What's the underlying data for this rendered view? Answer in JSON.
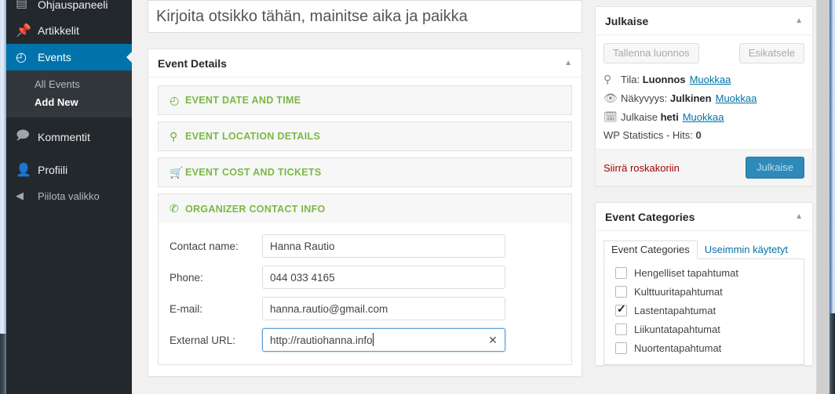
{
  "sidebar": {
    "items": [
      {
        "label": "Ohjauspaneeli",
        "icon": "dashboard-icon",
        "glyph": "▤",
        "state": "partial"
      },
      {
        "label": "Artikkelit",
        "icon": "pin-icon",
        "glyph": "📌",
        "state": "normal"
      },
      {
        "label": "Events",
        "icon": "events-clock-icon",
        "glyph": "◴",
        "state": "current"
      },
      {
        "label": "Kommentit",
        "icon": "comment-icon",
        "glyph": "🗩",
        "state": "normal"
      },
      {
        "label": "Profiili",
        "icon": "user-icon",
        "glyph": "👤",
        "state": "normal"
      }
    ],
    "submenu": [
      {
        "label": "All Events",
        "current": false
      },
      {
        "label": "Add New",
        "current": true
      }
    ],
    "collapse": {
      "label": "Piilota valikko",
      "icon": "collapse-arrow-icon",
      "glyph": "◀"
    }
  },
  "editor": {
    "title_placeholder": "Kirjoita otsikko tähän, mainitse aika ja paikka",
    "title_value": ""
  },
  "event_details": {
    "panel_title": "Event Details",
    "toggle_glyph": "▲",
    "sections": [
      {
        "label": "EVENT DATE AND TIME",
        "icon": "clock-icon",
        "glyph": "◴",
        "open": false
      },
      {
        "label": "EVENT LOCATION DETAILS",
        "icon": "map-pin-icon",
        "glyph": "⚲",
        "open": false
      },
      {
        "label": "EVENT COST AND TICKETS",
        "icon": "shopping-cart-icon",
        "glyph": "🛒",
        "open": false
      },
      {
        "label": "ORGANIZER CONTACT INFO",
        "icon": "phone-icon",
        "glyph": "✆",
        "open": true
      }
    ],
    "contact_fields": [
      {
        "label": "Contact name:",
        "value": "Hanna Rautio",
        "focused": false,
        "clearable": false
      },
      {
        "label": "Phone:",
        "value": "044 033 4165",
        "focused": false,
        "clearable": false
      },
      {
        "label": "E-mail:",
        "value": "hanna.rautio@gmail.com",
        "focused": false,
        "clearable": false
      },
      {
        "label": "External URL:",
        "value": "http://rautiohanna.info",
        "focused": true,
        "clearable": true
      }
    ],
    "clear_glyph": "✕"
  },
  "publish": {
    "panel_title": "Julkaise",
    "toggle_glyph": "▲",
    "save_draft_label": "Tallenna luonnos",
    "preview_label": "Esikatsele",
    "rows": [
      {
        "icon": "key-icon",
        "glyph": "⚲",
        "prefix": "Tila:",
        "value": "Luonnos",
        "link": "Muokkaa"
      },
      {
        "icon": "eye-icon",
        "glyph": "👁",
        "prefix": "Näkyvyys:",
        "value": "Julkinen",
        "link": "Muokkaa"
      },
      {
        "icon": "calendar-icon",
        "glyph": "🗓",
        "prefix": "Julkaise",
        "value": "heti",
        "link": "Muokkaa"
      }
    ],
    "statistics_label": "WP Statistics - Hits:",
    "statistics_value": "0",
    "trash_label": "Siirrä roskakoriin",
    "publish_label": "Julkaise",
    "accent_blue": "#2e8ab8",
    "trash_red": "#a00"
  },
  "categories": {
    "panel_title": "Event Categories",
    "toggle_glyph": "▲",
    "tabs": [
      {
        "label": "Event Categories",
        "active": true
      },
      {
        "label": "Useimmin käytetyt",
        "active": false
      }
    ],
    "items": [
      {
        "label": "Hengelliset tapahtumat",
        "checked": false
      },
      {
        "label": "Kulttuuritapahtumat",
        "checked": false
      },
      {
        "label": "Lastentapahtumat",
        "checked": true
      },
      {
        "label": "Liikuntatapahtumat",
        "checked": false
      },
      {
        "label": "Nuortentapahtumat",
        "checked": false
      }
    ]
  }
}
